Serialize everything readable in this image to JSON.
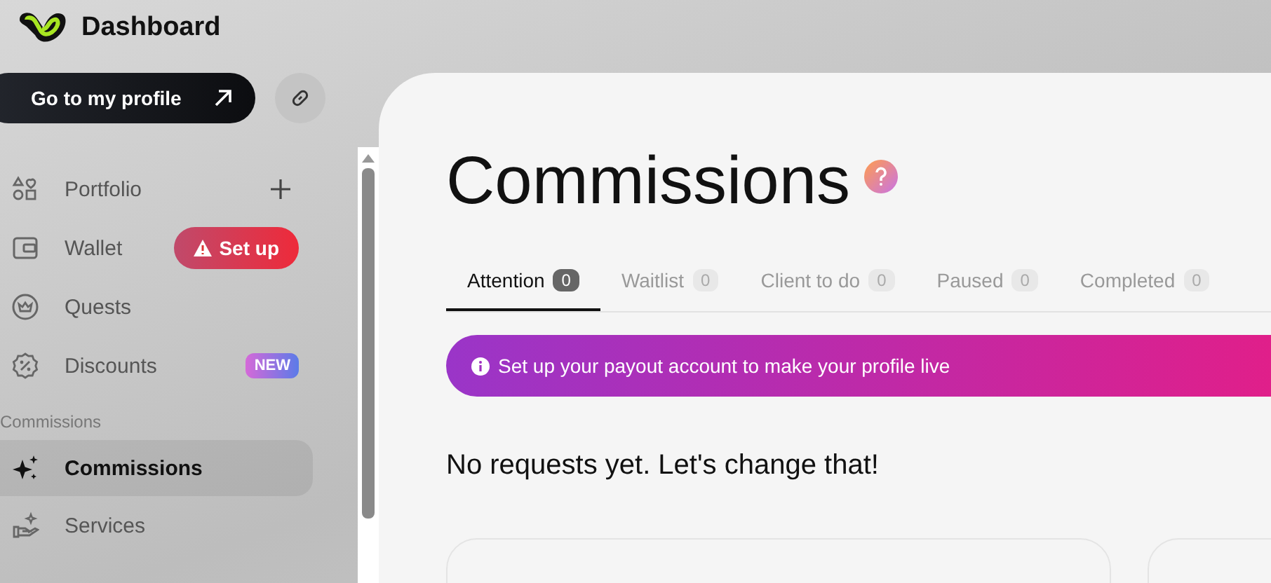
{
  "brand": {
    "title": "Dashboard"
  },
  "profile_button": {
    "label": "Go to my profile"
  },
  "sidebar": {
    "items": [
      {
        "label": "Portfolio",
        "selected": false,
        "action": {
          "kind": "add"
        }
      },
      {
        "label": "Wallet",
        "selected": false,
        "action": {
          "kind": "warning",
          "label": "Set up"
        }
      },
      {
        "label": "Quests",
        "selected": false
      },
      {
        "label": "Discounts",
        "selected": false,
        "action": {
          "kind": "new",
          "label": "NEW"
        }
      },
      {
        "kind": "section",
        "label": "Commissions"
      },
      {
        "label": "Commissions",
        "selected": true
      },
      {
        "label": "Services",
        "selected": false
      }
    ]
  },
  "page": {
    "title": "Commissions",
    "tabs": [
      {
        "label": "Attention",
        "count": "0",
        "selected": true
      },
      {
        "label": "Waitlist",
        "count": "0",
        "selected": false
      },
      {
        "label": "Client to do",
        "count": "0",
        "selected": false
      },
      {
        "label": "Paused",
        "count": "0",
        "selected": false
      },
      {
        "label": "Completed",
        "count": "0",
        "selected": false
      }
    ],
    "banner": "Set up your payout account to make your profile live",
    "empty_message": "No requests yet. Let's change that!"
  }
}
